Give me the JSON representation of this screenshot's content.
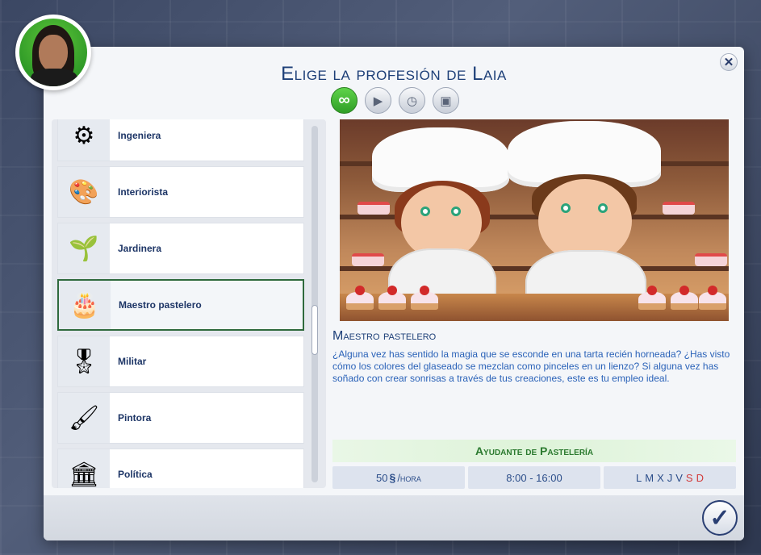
{
  "dialog": {
    "title": "Elige la profesión de Laia",
    "close_label": "✕",
    "confirm_label": "✓"
  },
  "tabs": [
    {
      "name": "tab-all-careers",
      "icon": "infinity-icon",
      "glyph": "∞",
      "active": true
    },
    {
      "name": "tab-active-career",
      "icon": "briefcase-play-icon",
      "glyph": "▶",
      "active": false
    },
    {
      "name": "tab-part-time",
      "icon": "briefcase-clock-icon",
      "glyph": "◷",
      "active": false
    },
    {
      "name": "tab-freelance",
      "icon": "briefcase-icon",
      "glyph": "▣",
      "active": false
    }
  ],
  "careers": [
    {
      "label": "Ingeniera",
      "icon": "gears-icon",
      "glyph": "⚙",
      "selected": false
    },
    {
      "label": "Interiorista",
      "icon": "color-swatches-icon",
      "glyph": "🎨",
      "selected": false
    },
    {
      "label": "Jardinera",
      "icon": "plant-hands-icon",
      "glyph": "🌱",
      "selected": false
    },
    {
      "label": "Maestro pastelero",
      "icon": "cake-icon",
      "glyph": "🎂",
      "selected": true
    },
    {
      "label": "Militar",
      "icon": "chevron-rank-icon",
      "glyph": "🎖",
      "selected": false
    },
    {
      "label": "Pintora",
      "icon": "paintbrush-icon",
      "glyph": "🖌",
      "selected": false
    },
    {
      "label": "Política",
      "icon": "podium-icon",
      "glyph": "🏛",
      "selected": false
    }
  ],
  "detail": {
    "name": "Maestro pastelero",
    "description": "¿Alguna vez has sentido la magia que se esconde en una tarta recién horneada? ¿Has visto cómo los colores del glaseado se mezclan como pinceles en un lienzo? Si alguna vez has soñado con crear sonrisas a través de tus creaciones, este es tu empleo ideal.",
    "level_title": "Ayudante de Pastelería",
    "pay_amount": "50",
    "pay_currency": "§",
    "pay_unit": "/hora",
    "hours": "8:00 - 16:00",
    "days": [
      {
        "d": "L",
        "off": false
      },
      {
        "d": "M",
        "off": false
      },
      {
        "d": "X",
        "off": false
      },
      {
        "d": "J",
        "off": false
      },
      {
        "d": "V",
        "off": false
      },
      {
        "d": "S",
        "off": true
      },
      {
        "d": "D",
        "off": true
      }
    ]
  },
  "colors": {
    "accent": "#1d3f78",
    "selected_border": "#2f6a3d",
    "active_tab": "#3cae2f",
    "day_off": "#d23a3a"
  }
}
